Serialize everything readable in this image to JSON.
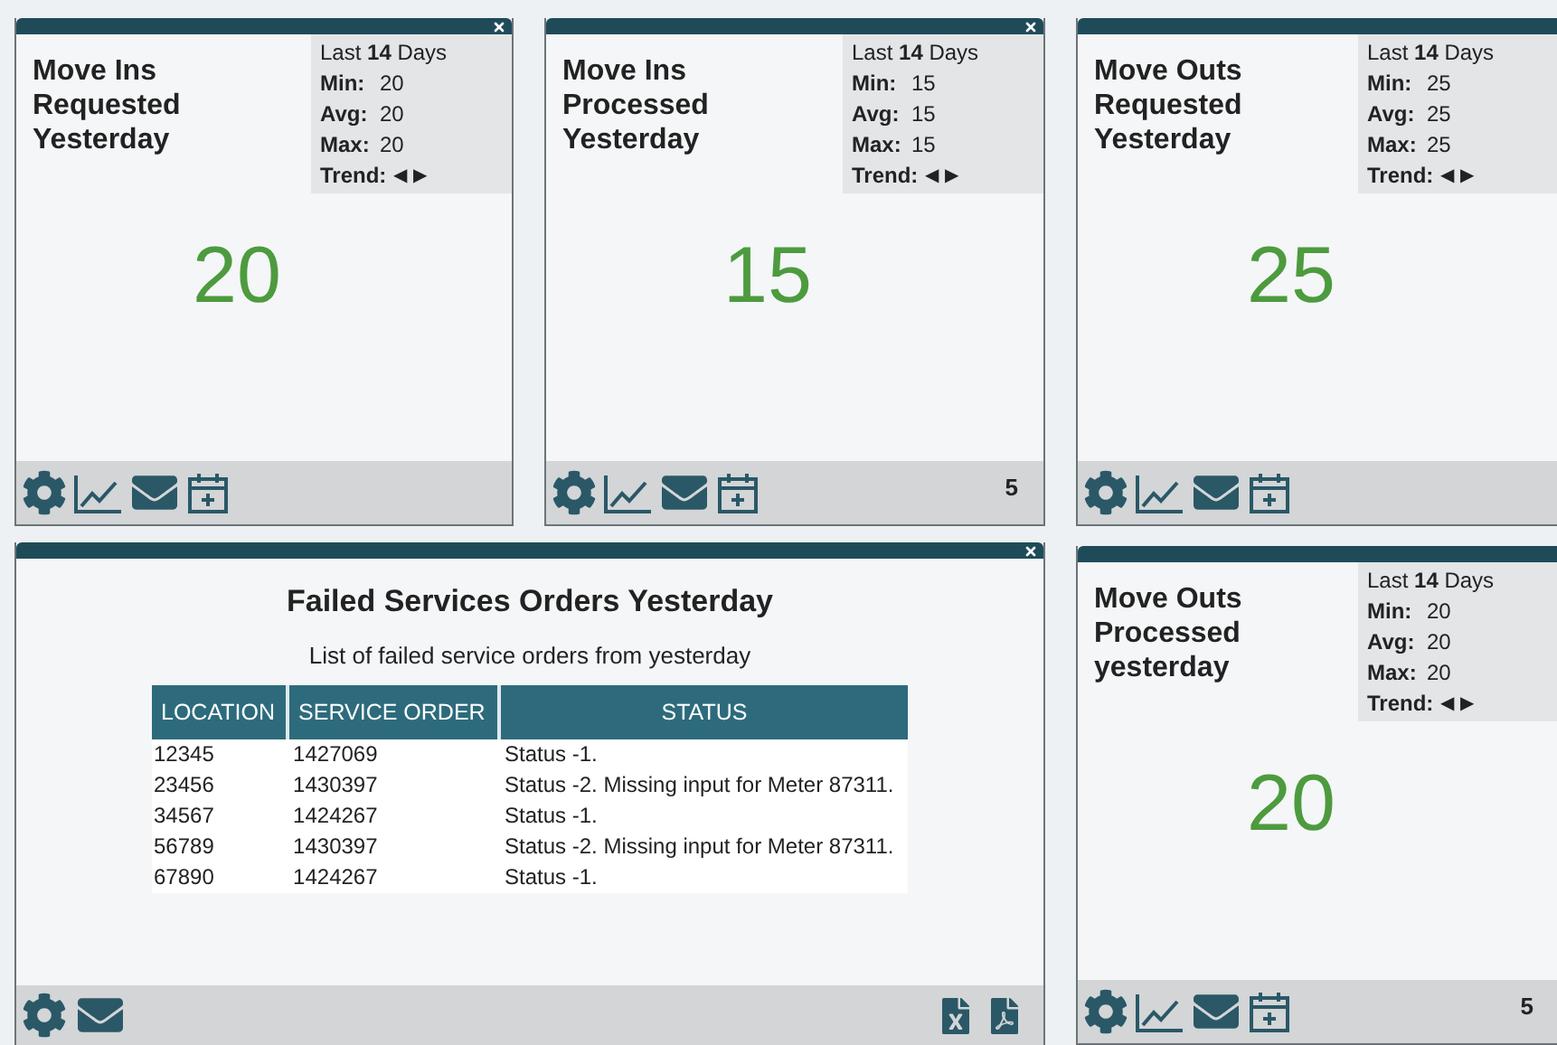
{
  "widgets": [
    {
      "kind": "metric",
      "title": "Move Ins Requested Yesterday",
      "closable": true,
      "stats_heading": "Last **14** Days",
      "stats": [
        {
          "label": "Min:",
          "value": "20"
        },
        {
          "label": "Avg:",
          "value": "20"
        },
        {
          "label": "Max:",
          "value": "20"
        }
      ],
      "trend_label": "Trend:",
      "trend_arrows": "◀ ▶",
      "value": "20",
      "footer_icons": [
        {
          "kind": "gear"
        },
        {
          "kind": "chart"
        },
        {
          "kind": "mail"
        },
        {
          "kind": "calendar"
        }
      ]
    },
    {
      "kind": "metric",
      "title": "Move Ins Processed Yesterday",
      "closable": true,
      "stats_heading": "Last **14** Days",
      "stats": [
        {
          "label": "Min:",
          "value": "15"
        },
        {
          "label": "Avg:",
          "value": "15"
        },
        {
          "label": "Max:",
          "value": "15"
        }
      ],
      "trend_label": "Trend:",
      "trend_arrows": "◀ ▶",
      "value": "15",
      "footer_icons": [
        {
          "kind": "gear"
        },
        {
          "kind": "chart"
        },
        {
          "kind": "mail"
        },
        {
          "kind": "calendar"
        }
      ],
      "count": "5"
    },
    {
      "kind": "metric",
      "title": "Move Outs Requested Yesterday",
      "closable": false,
      "stats_heading": "Last **14** Days",
      "stats": [
        {
          "label": "Min:",
          "value": "25"
        },
        {
          "label": "Avg:",
          "value": "25"
        },
        {
          "label": "Max:",
          "value": "25"
        }
      ],
      "trend_label": "Trend:",
      "trend_arrows": "◀ ▶",
      "value": "25",
      "footer_icons": [
        {
          "kind": "gear"
        },
        {
          "kind": "chart"
        },
        {
          "kind": "mail"
        },
        {
          "kind": "calendar"
        }
      ]
    },
    {
      "kind": "table",
      "title": "Failed Services Orders Yesterday",
      "closable": true,
      "subtitle": "List of failed service orders from yesterday",
      "columns": [
        "LOCATION",
        "SERVICE ORDER",
        "STATUS"
      ],
      "rows": [
        [
          "12345",
          "1427069",
          "Status -1."
        ],
        [
          "23456",
          "1430397",
          "Status -2. Missing input for Meter 87311."
        ],
        [
          "34567",
          "1424267",
          "Status -1."
        ],
        [
          "56789",
          "1430397",
          "Status -2. Missing input for Meter 87311."
        ],
        [
          "67890",
          "1424267",
          "Status -1."
        ]
      ],
      "footer_icons": [
        {
          "kind": "gear"
        },
        {
          "kind": "mail"
        }
      ],
      "export_icons": [
        {
          "kind": "excel"
        },
        {
          "kind": "pdf"
        }
      ]
    },
    {
      "kind": "metric",
      "title": "Move Outs Processed yesterday",
      "closable": false,
      "stats_heading": "Last **14** Days",
      "stats": [
        {
          "label": "Min:",
          "value": "20"
        },
        {
          "label": "Avg:",
          "value": "20"
        },
        {
          "label": "Max:",
          "value": "20"
        }
      ],
      "trend_label": "Trend:",
      "trend_arrows": "◀ ▶",
      "value": "20",
      "footer_icons": [
        {
          "kind": "gear"
        },
        {
          "kind": "chart"
        },
        {
          "kind": "mail"
        },
        {
          "kind": "calendar"
        }
      ],
      "count": "5"
    }
  ]
}
